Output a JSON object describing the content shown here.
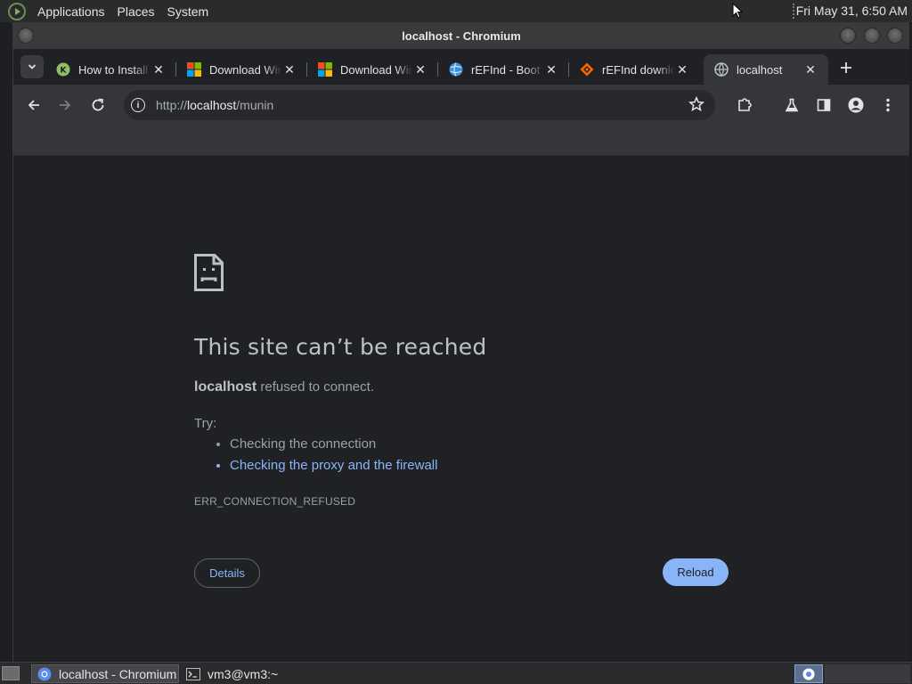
{
  "top_panel": {
    "menus": [
      "Applications",
      "Places",
      "System"
    ],
    "clock": "Fri May 31,  6:50 AM"
  },
  "window": {
    "title": "localhost - Chromium"
  },
  "tabs": [
    {
      "label": "How to Install",
      "favicon": "install-site-icon",
      "active": false
    },
    {
      "label": "Download Windows",
      "favicon": "microsoft-icon",
      "active": false
    },
    {
      "label": "Download Windows",
      "favicon": "microsoft-icon",
      "active": false
    },
    {
      "label": "rEFInd - Boot",
      "favicon": "refind-globe-icon",
      "active": false
    },
    {
      "label": "rEFInd download",
      "favicon": "sourceforge-icon",
      "active": false
    },
    {
      "label": "localhost",
      "favicon": "globe-icon",
      "active": true
    }
  ],
  "omnibox": {
    "scheme": "http://",
    "host": "localhost",
    "path": "/munin"
  },
  "error_page": {
    "title": "This site can’t be reached",
    "host": "localhost",
    "description_suffix": " refused to connect.",
    "try_label": "Try:",
    "suggestions": [
      {
        "text": "Checking the connection",
        "link": false
      },
      {
        "text": "Checking the proxy and the firewall",
        "link": true
      }
    ],
    "error_code": "ERR_CONNECTION_REFUSED",
    "details_label": "Details",
    "reload_label": "Reload"
  },
  "taskbar": {
    "tasks": [
      {
        "label": "localhost - Chromium",
        "icon": "chromium-icon",
        "active": true
      },
      {
        "label": "vm3@vm3:~",
        "icon": "terminal-icon",
        "active": false
      }
    ]
  },
  "colors": {
    "accent": "#8ab4f8",
    "page_bg": "#202124",
    "toolbar_bg": "#35363a"
  }
}
